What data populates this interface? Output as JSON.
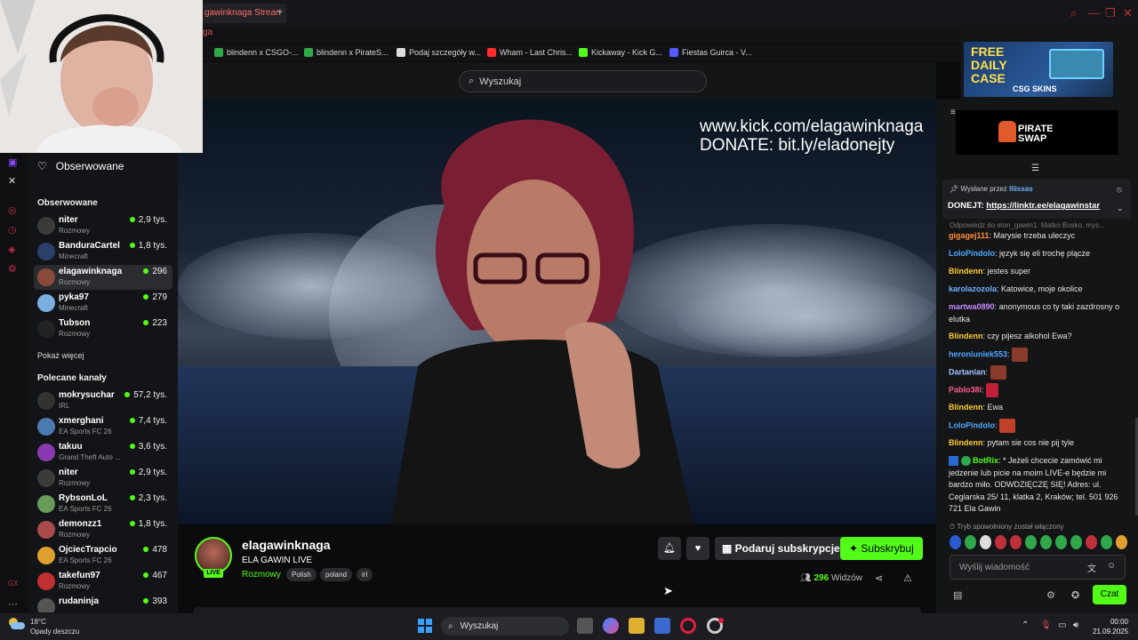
{
  "browser": {
    "active_tab": "gawinknaga Strean",
    "address_fragment": "ga",
    "new_tab_icon": "+",
    "bookmarks": [
      {
        "label": "blindenn x CSGO-...",
        "color": "#2fa84a"
      },
      {
        "label": "blindenn x PirateS...",
        "color": "#2fa84a"
      },
      {
        "label": "Podaj szczegóły w...",
        "color": "#dddddd"
      },
      {
        "label": "Wham - Last Chris...",
        "color": "#ff2b2b"
      },
      {
        "label": "Kickaway - Kick G...",
        "color": "#53fc18"
      },
      {
        "label": "Fiestas Guirca - V...",
        "color": "#5858ff"
      }
    ]
  },
  "header": {
    "search_placeholder": "Wyszukaj"
  },
  "video": {
    "overlay_line1": "www.kick.com/elagawinknaga",
    "overlay_line2": "DONATE: bit.ly/eladonejty"
  },
  "sidebar": {
    "favorites_label": "Obserwowane",
    "followed_heading": "Obserwowane",
    "followed": [
      {
        "name": "niter",
        "category": "Rozmowy",
        "viewers": "2,9 tys.",
        "selected": false
      },
      {
        "name": "BanduraCartel",
        "category": "Minecraft",
        "viewers": "1,8 tys.",
        "selected": false
      },
      {
        "name": "elagawinknaga",
        "category": "Rozmowy",
        "viewers": "296",
        "selected": true
      },
      {
        "name": "pyka97",
        "category": "Minecraft",
        "viewers": "279",
        "selected": false
      },
      {
        "name": "Tubson",
        "category": "Rozmowy",
        "viewers": "223",
        "selected": false
      }
    ],
    "show_more": "Pokaż więcej",
    "recommended_heading": "Polecane kanały",
    "recommended": [
      {
        "name": "mokrysuchar",
        "category": "IRL",
        "viewers": "57,2 tys."
      },
      {
        "name": "xmerghani",
        "category": "EA Sports FC 26",
        "viewers": "7,4 tys."
      },
      {
        "name": "takuu",
        "category": "Grand Theft Auto ...",
        "viewers": "3,6 tys."
      },
      {
        "name": "niter",
        "category": "Rozmowy",
        "viewers": "2,9 tys."
      },
      {
        "name": "RybsonLoL",
        "category": "EA Sports FC 26",
        "viewers": "2,3 tys."
      },
      {
        "name": "demonzz1",
        "category": "Rozmowy",
        "viewers": "1,8 tys."
      },
      {
        "name": "OjciecTrapcio",
        "category": "EA Sports FC 26",
        "viewers": "478"
      },
      {
        "name": "takefun97",
        "category": "Rozmowy",
        "viewers": "467"
      },
      {
        "name": "rudaninja",
        "category": "",
        "viewers": "393"
      }
    ]
  },
  "stream_info": {
    "streamer": "elagawinknaga",
    "live_label": "LIVE",
    "title": "ELA GAWIN LIVE",
    "category": "Rozmowy",
    "tags": [
      "Polish",
      "poland",
      "irl"
    ],
    "gift_label": "Podaruj subskrypcje",
    "subscribe_label": "Subskrybuj",
    "viewer_count": "296",
    "viewer_word": "Widzów"
  },
  "chat": {
    "ad_csgo_line1": "FREE",
    "ad_csgo_line2": "DAILY",
    "ad_csgo_line3": "CASE",
    "ad_csgo_brand": "CSG SKINS",
    "ad_pirate_line1": "PIRATE",
    "ad_pirate_line2": "SWAP",
    "pinned_by_label": "Wysłane przez",
    "pinned_by_user": "lliissas",
    "pinned_prefix": "DONEJT:",
    "pinned_link": "https://linktr.ee/elagawinstar",
    "reply_note": "Odpowiedz do elon_gawin1: Matko Bosko, mys...",
    "messages": [
      {
        "user": "gigagej111",
        "color": "#ff8c3a",
        "text": "Marysie trzeba uleczyc"
      },
      {
        "user": "LoloPindolo",
        "color": "#4fa8ff",
        "text": "język się eli trochę plącze"
      },
      {
        "user": "Blindenn",
        "color": "#ffcc33",
        "text": "jestes super"
      },
      {
        "user": "karolazozola",
        "color": "#6fb3ff",
        "text": "Katowice, moje okolice"
      },
      {
        "user": "martwa0890",
        "color": "#c68aff",
        "text": "anonymous co ty taki zazdrosny o elutka"
      },
      {
        "user": "Blindenn",
        "color": "#ffcc33",
        "text": "czy pijesz alkohol Ewa?"
      },
      {
        "user": "heroniuniek553",
        "color": "#4fa8ff",
        "text": ""
      },
      {
        "user": "Dartanian",
        "color": "#9fc4ff",
        "text": ""
      },
      {
        "user": "Pablo38i",
        "color": "#ff5c8a",
        "text": ""
      },
      {
        "user": "Blindenn",
        "color": "#ffcc33",
        "text": "Ewa"
      },
      {
        "user": "LoloPindolo",
        "color": "#4fa8ff",
        "text": ""
      },
      {
        "user": "Blindenn",
        "color": "#ffcc33",
        "text": "pytam sie cos nie pij tyle"
      },
      {
        "user": "BotRix",
        "color": "#53fc18",
        "text": "* Jeżeli chcecie zamówić mi jedzenie lub picie na moim LIVE-e będzie mi bardzo miło. ODWDZIĘCZĘ SIĘ! Adres: ul. Ceglarska 25/ 11, klatka 2, Kraków; tel. 501 926 721 Ela Gawin"
      }
    ],
    "slow_mode_note": "Tryb spowolniony został włączony",
    "input_placeholder": "Wyślij wiadomość",
    "send_label": "Czat"
  },
  "taskbar": {
    "temperature": "18°C",
    "weather": "Opady deszczu",
    "search_label": "Wyszukaj",
    "time": "00:00",
    "date": "21.09.2025"
  },
  "colors": {
    "accent": "#53fc18",
    "background": "#0b0b0d",
    "panel": "#131417",
    "browser_accent": "#ff4040"
  }
}
